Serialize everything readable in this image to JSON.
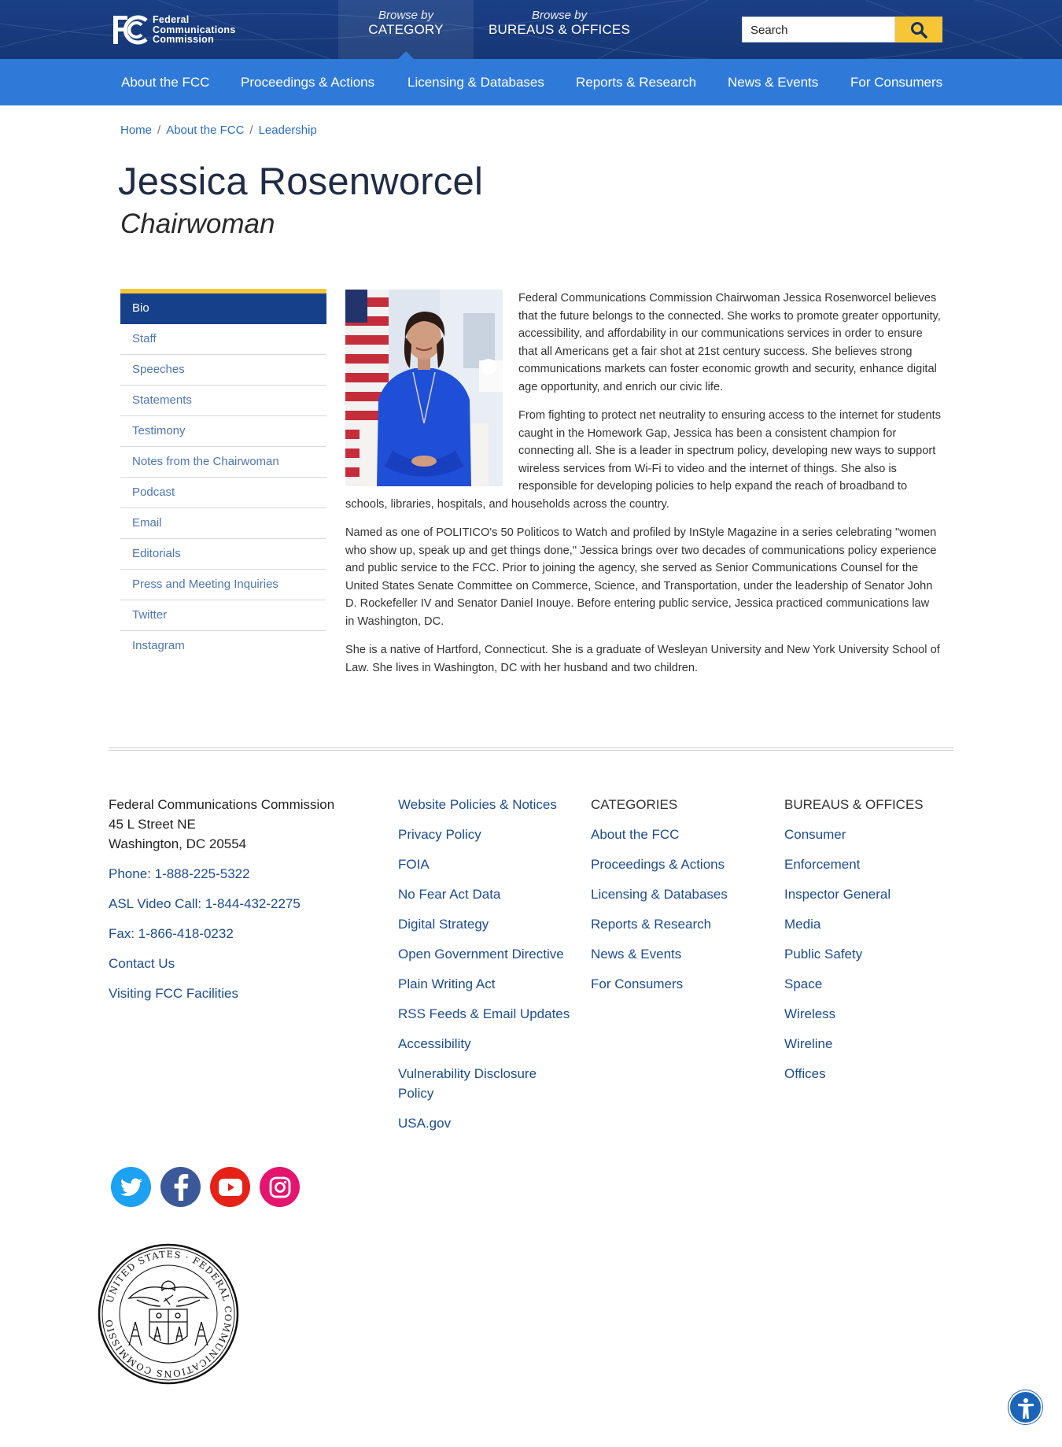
{
  "header": {
    "logo_lines": [
      "Federal",
      "Communications",
      "Commission"
    ],
    "browse_category": {
      "prefix": "Browse by",
      "label": "CATEGORY"
    },
    "browse_bureaus": {
      "prefix": "Browse by",
      "label": "BUREAUS & OFFICES"
    },
    "search_placeholder": "Search"
  },
  "nav": [
    "About the FCC",
    "Proceedings & Actions",
    "Licensing & Databases",
    "Reports & Research",
    "News & Events",
    "For Consumers"
  ],
  "breadcrumb": [
    "Home",
    "About the FCC",
    "Leadership"
  ],
  "page": {
    "title": "Jessica Rosenworcel",
    "subtitle": "Chairwoman"
  },
  "sidenav": [
    "Bio",
    "Staff",
    "Speeches",
    "Statements",
    "Testimony",
    "Notes from the Chairwoman",
    "Podcast",
    "Email",
    "Editorials",
    "Press and Meeting Inquiries",
    "Twitter",
    "Instagram"
  ],
  "bio": [
    "Federal Communications Commission Chairwoman Jessica Rosenworcel believes that the future belongs to the connected. She works to promote greater opportunity, accessibility, and affordability in our communications services in order to ensure that all Americans get a fair shot at 21st century success. She believes strong communications markets can foster economic growth and security, enhance digital age opportunity, and enrich our civic life.",
    "From fighting to protect net neutrality to ensuring access to the internet for students caught in the Homework Gap, Jessica has been a consistent champion for connecting all. She is a leader in spectrum policy, developing new ways to support wireless services from Wi-Fi to video and the internet of things. She also is responsible for developing policies to help expand the reach of broadband to schools, libraries, hospitals, and households across the country.",
    "Named as one of POLITICO's 50 Politicos to Watch and profiled by InStyle Magazine in a series celebrating \"women who show up, speak up and get things done,\" Jessica brings over two decades of communications policy experience and public service to the FCC. Prior to joining the agency, she served as Senior Communications Counsel for the United States Senate Committee on Commerce, Science, and Transportation, under the leadership of Senator John D. Rockefeller IV and Senator Daniel Inouye. Before entering public service, Jessica practiced communications law in Washington, DC.",
    "She is a native of Hartford, Connecticut. She is a graduate of Wesleyan University and New York University School of Law. She lives in Washington, DC with her husband and two children."
  ],
  "footer": {
    "address": [
      "Federal Communications Commission",
      "45 L Street NE",
      "Washington, DC 20554"
    ],
    "contact_links": [
      "Phone: 1-888-225-5322",
      "ASL Video Call: 1-844-432-2275",
      "Fax: 1-866-418-0232",
      "Contact Us",
      "Visiting FCC Facilities"
    ],
    "policy_links": [
      "Website Policies & Notices",
      "Privacy Policy",
      "FOIA",
      "No Fear Act Data",
      "Digital Strategy",
      "Open Government Directive",
      "Plain Writing Act",
      "RSS Feeds & Email Updates",
      "Accessibility",
      "Vulnerability Disclosure Policy",
      "USA.gov"
    ],
    "categories_heading": "CATEGORIES",
    "categories": [
      "About the FCC",
      "Proceedings & Actions",
      "Licensing & Databases",
      "Reports & Research",
      "News & Events",
      "For Consumers"
    ],
    "bureaus_heading": "BUREAUS & OFFICES",
    "bureaus": [
      "Consumer",
      "Enforcement",
      "Inspector General",
      "Media",
      "Public Safety",
      "Space",
      "Wireless",
      "Wireline",
      "Offices"
    ],
    "social": [
      {
        "name": "twitter-icon",
        "color": "#1da1f2"
      },
      {
        "name": "facebook-icon",
        "color": "#3b5998"
      },
      {
        "name": "youtube-icon",
        "color": "#e62117"
      },
      {
        "name": "instagram-icon",
        "color": "#e4156e"
      }
    ],
    "seal_text": "UNITED STATES · FEDERAL COMMUNICATIONS COMMISSION"
  },
  "colors": {
    "header_dark": "#1b3f85",
    "nav_blue": "#2f7ad9",
    "accent_yellow": "#f6c637",
    "link_blue": "#1c4c8f"
  }
}
